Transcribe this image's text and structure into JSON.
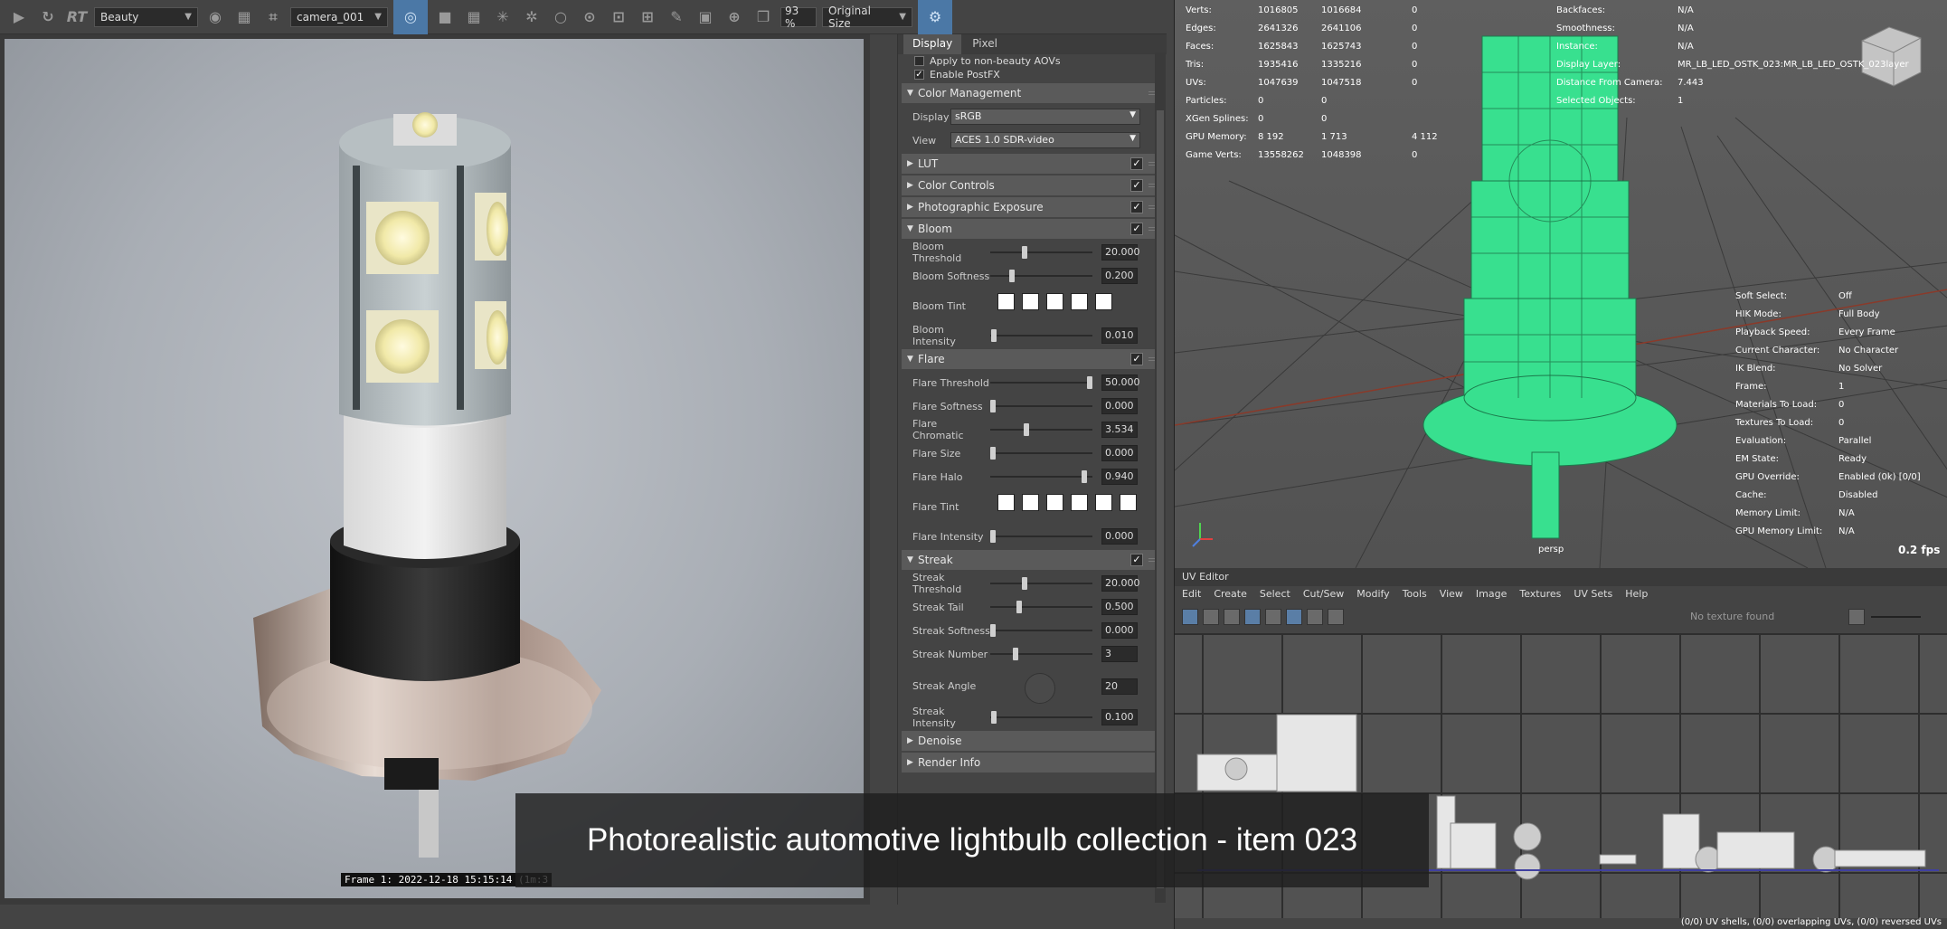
{
  "toolbar": {
    "rt_label": "RT",
    "aov_select": "Beauty",
    "camera_select": "camera_001",
    "zoom_value": "93 %",
    "size_select": "Original Size"
  },
  "render_view": {
    "frame_label": "Frame  1:  2022-12-18  15:15:14  (1m:3"
  },
  "panel": {
    "tabs": [
      "Display",
      "Pixel"
    ],
    "top_checks": [
      {
        "label": "Apply to non-beauty AOVs",
        "checked": false
      },
      {
        "label": "Enable PostFX",
        "checked": true
      }
    ],
    "color_management": {
      "title": "Color Management",
      "display_label": "Display",
      "display_value": "sRGB",
      "view_label": "View",
      "view_value": "ACES 1.0 SDR-video"
    },
    "collapsed_sections": [
      "LUT",
      "Color Controls",
      "Photographic Exposure"
    ],
    "bloom": {
      "title": "Bloom",
      "rows": [
        {
          "label": "Bloom Threshold",
          "value": "20.000",
          "pos": 0.33
        },
        {
          "label": "Bloom Softness",
          "value": "0.200",
          "pos": 0.2
        },
        {
          "label": "Bloom Tint",
          "type": "tint",
          "count": 5
        },
        {
          "label": "Bloom Intensity",
          "value": "0.010",
          "pos": 0.01
        }
      ]
    },
    "flare": {
      "title": "Flare",
      "rows": [
        {
          "label": "Flare Threshold",
          "value": "50.000",
          "pos": 1.0
        },
        {
          "label": "Flare Softness",
          "value": "0.000",
          "pos": 0.0
        },
        {
          "label": "Flare Chromatic",
          "value": "3.534",
          "pos": 0.35
        },
        {
          "label": "Flare Size",
          "value": "0.000",
          "pos": 0.0
        },
        {
          "label": "Flare Halo",
          "value": "0.940",
          "pos": 0.94
        },
        {
          "label": "Flare Tint",
          "type": "tint",
          "count": 6
        },
        {
          "label": "Flare Intensity",
          "value": "0.000",
          "pos": 0.0
        }
      ]
    },
    "streak": {
      "title": "Streak",
      "rows": [
        {
          "label": "Streak Threshold",
          "value": "20.000",
          "pos": 0.33
        },
        {
          "label": "Streak Tail",
          "value": "0.500",
          "pos": 0.27
        },
        {
          "label": "Streak Softness",
          "value": "0.000",
          "pos": 0.0
        },
        {
          "label": "Streak Number",
          "value": "3",
          "pos": 0.23
        },
        {
          "label": "Streak Angle",
          "value": "20",
          "type": "dial"
        },
        {
          "label": "Streak Intensity",
          "value": "0.100",
          "pos": 0.01
        }
      ]
    },
    "bottom_sections": [
      "Denoise",
      "Render Info"
    ]
  },
  "viewport": {
    "stats": [
      {
        "label": "Verts:",
        "a": "1016805",
        "b": "1016684",
        "c": "0"
      },
      {
        "label": "Edges:",
        "a": "2641326",
        "b": "2641106",
        "c": "0"
      },
      {
        "label": "Faces:",
        "a": "1625843",
        "b": "1625743",
        "c": "0"
      },
      {
        "label": "Tris:",
        "a": "1935416",
        "b": "1335216",
        "c": "0"
      },
      {
        "label": "UVs:",
        "a": "1047639",
        "b": "1047518",
        "c": "0"
      },
      {
        "label": "Particles:",
        "a": "0",
        "b": "0",
        "c": ""
      },
      {
        "label": "XGen Splines:",
        "a": "0",
        "b": "0",
        "c": ""
      },
      {
        "label": "GPU Memory:",
        "a": "8 192",
        "b": "1 713",
        "c": "4 112"
      },
      {
        "label": "Game Verts:",
        "a": "13558262",
        "b": "1048398",
        "c": "0"
      }
    ],
    "right_stats": [
      {
        "label": "Backfaces:",
        "value": "N/A"
      },
      {
        "label": "Smoothness:",
        "value": "N/A"
      },
      {
        "label": "Instance:",
        "value": "N/A"
      },
      {
        "label": "Display Layer:",
        "value": "MR_LB_LED_OSTK_023:MR_LB_LED_OSTK_023layer"
      },
      {
        "label": "Distance From Camera:",
        "value": "7.443"
      },
      {
        "label": "Selected Objects:",
        "value": "1"
      }
    ],
    "hud_right": [
      {
        "label": "Soft Select:",
        "value": "Off"
      },
      {
        "label": "HIK Mode:",
        "value": "Full Body"
      },
      {
        "label": "Playback Speed:",
        "value": "Every Frame"
      },
      {
        "label": "Current Character:",
        "value": "No Character"
      },
      {
        "label": "IK Blend:",
        "value": "No Solver"
      },
      {
        "label": "Frame:",
        "value": "1"
      },
      {
        "label": "Materials To Load:",
        "value": "0"
      },
      {
        "label": "Textures To Load:",
        "value": "0"
      },
      {
        "label": "Evaluation:",
        "value": "Parallel"
      },
      {
        "label": "EM State:",
        "value": "Ready"
      },
      {
        "label": "GPU Override:",
        "value": "Enabled (0k) [0/0]"
      },
      {
        "label": "Cache:",
        "value": "Disabled"
      },
      {
        "label": "Memory Limit:",
        "value": "N/A"
      },
      {
        "label": "GPU Memory Limit:",
        "value": "N/A"
      }
    ],
    "camera_label": "persp",
    "fps": "0.2 fps"
  },
  "uv_editor": {
    "title": "UV Editor",
    "menu": [
      "Edit",
      "Create",
      "Select",
      "Cut/Sew",
      "Modify",
      "Tools",
      "View",
      "Image",
      "Textures",
      "UV Sets",
      "Help"
    ],
    "texture_status": "No texture found",
    "status": "(0/0) UV shells, (0/0) overlapping UVs, (0/0) reversed UVs"
  },
  "caption": "Photorealistic automotive lightbulb collection - item 023",
  "colors": {
    "wireframe": "#38e08f",
    "accent": "#4b78a6"
  }
}
